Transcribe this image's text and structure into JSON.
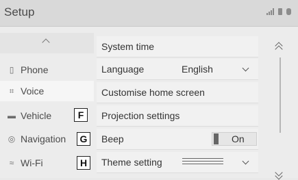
{
  "header": {
    "title": "Setup"
  },
  "sidebar": {
    "items": [
      {
        "label": "Phone",
        "icon": "phone-icon"
      },
      {
        "label": "Voice",
        "icon": "voice-icon"
      },
      {
        "label": "Vehicle",
        "icon": "car-icon"
      },
      {
        "label": "Navigation",
        "icon": "navigation-icon"
      },
      {
        "label": "Wi-Fi",
        "icon": "wifi-icon"
      }
    ]
  },
  "callouts": {
    "f": "F",
    "g": "G",
    "h": "H"
  },
  "list": {
    "system_time": "System time",
    "language": "Language",
    "language_value": "English",
    "customise": "Customise home screen",
    "projection": "Projection settings",
    "beep": "Beep",
    "beep_value": "On",
    "theme": "Theme setting"
  }
}
